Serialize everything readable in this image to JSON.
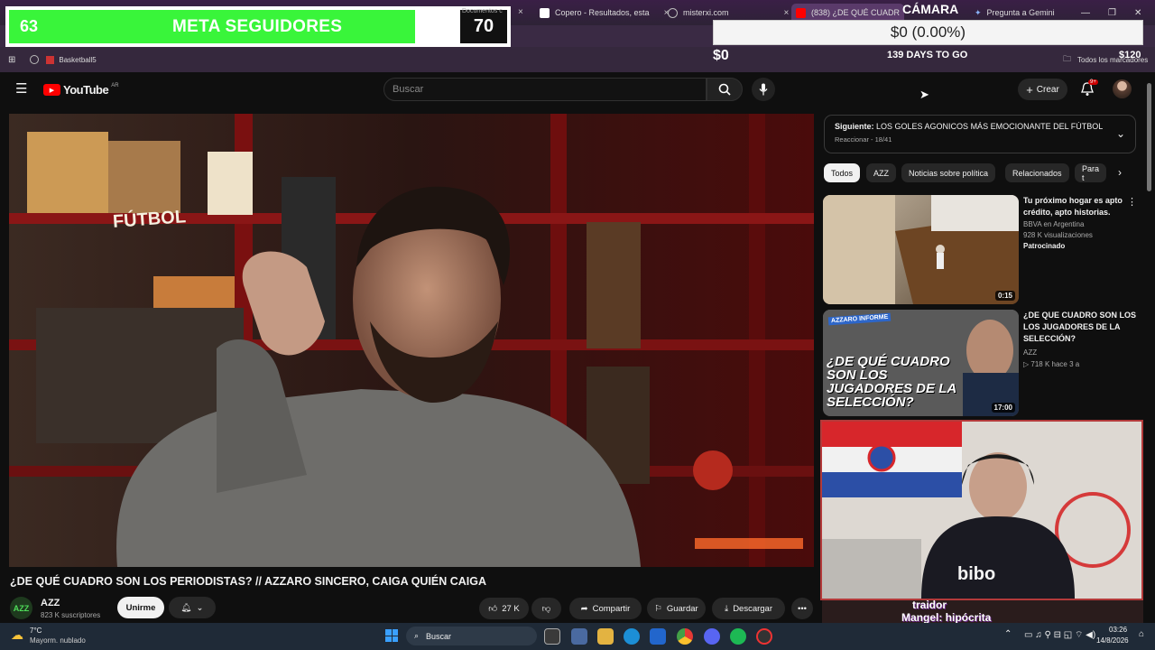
{
  "browser": {
    "tabs": [
      {
        "label": "Documentos c",
        "close": "×"
      },
      {
        "label": "Copero - Resultados, esta",
        "close": "×"
      },
      {
        "label": "misterxi.com",
        "close": "×"
      },
      {
        "label": "(838) ¿DE QUÉ CUADR",
        "close": "×"
      },
      {
        "label": "Pregunta a Gemini",
        "close": ""
      }
    ],
    "bookmarks": {
      "item": "Basketball5",
      "all": "Todos los marcadores"
    }
  },
  "overlay": {
    "meta_label": "META SEGUIDORES",
    "meta_current": "63",
    "meta_goal": "70",
    "meta_progress": 0.9,
    "camara": "CÁMARA",
    "donation_total": "$0 (0.00%)",
    "donation_left": "$0",
    "donation_days": "139 DAYS TO GO",
    "donation_right": "$120"
  },
  "youtube": {
    "logo": "YouTube",
    "region": "AR",
    "search_placeholder": "Buscar",
    "crear": "Crear",
    "notif_badge": "9+",
    "video_title": "¿DE QUÉ CUADRO SON LOS PERIODISTAS? // AZZARO SINCERO, CAIGA QUIÉN CAIGA",
    "channel": "AZZ",
    "subs": "823 K suscriptores",
    "join": "Unirme",
    "likes": "27 K",
    "share": "Compartir",
    "save": "Guardar",
    "download": "Descargar",
    "video_overlay_text": "FÚTBOL"
  },
  "sidebar": {
    "next_label": "Siguiente:",
    "next_title": "LOS GOLES AGONICOS MÁS EMOCIONANTE DEL FÚTBOL ...",
    "next_sub": "Reaccionar - 18/41",
    "chips": [
      "Todos",
      "AZZ",
      "Noticias sobre política",
      "Relacionados",
      "Para t"
    ],
    "videos": [
      {
        "title": "Tu próximo hogar es apto crédito, apto historias.",
        "channel": "BBVA en Argentina",
        "views": "928 K visualizaciones",
        "extra": "Patrocinado",
        "duration": "0:15"
      },
      {
        "title": "¿DE QUE CUADRO SON LOS LOS JUGADORES DE LA SELECCIÓN?",
        "channel": "AZZ",
        "views": "718 K",
        "extra": "hace 3 a",
        "duration": "17:00",
        "thumb_text": "¿DE QUÉ CUADRO SON LOS JUGADORES DE LA SELECCIÓN?",
        "thumb_tag": "AZZARO INFORME"
      }
    ],
    "bottom_text": [
      "traidor",
      "Mangel: hipócrita"
    ]
  },
  "taskbar": {
    "weather_temp": "7°C",
    "weather_desc": "Mayorm. nublado",
    "search": "Buscar",
    "time": "03:26",
    "date": "14/8/2026"
  }
}
